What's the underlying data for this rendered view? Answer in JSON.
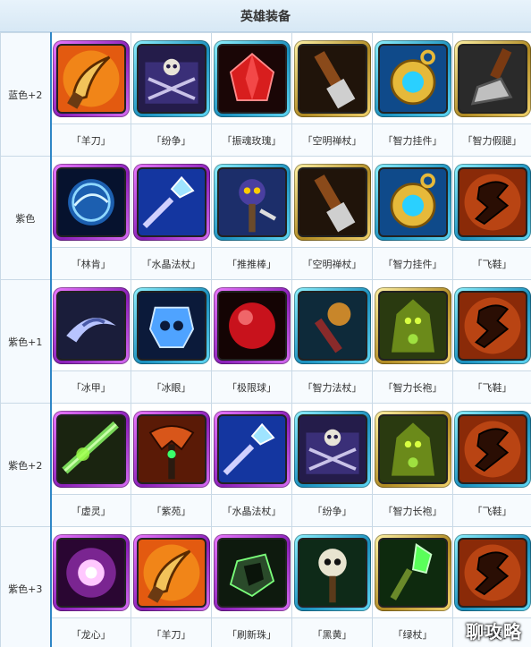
{
  "title": "英雄装备",
  "watermark": "聊攻略",
  "tiers": [
    {
      "label": "蓝色+2",
      "items": [
        {
          "name": "「羊刀」",
          "icon": "curved-blade-icon",
          "frame": "purple"
        },
        {
          "name": "「纷争」",
          "icon": "skull-chest-icon",
          "frame": "blue"
        },
        {
          "name": "「振魂玫瑰」",
          "icon": "red-crystal-icon",
          "frame": "blue"
        },
        {
          "name": "「空明禅杖」",
          "icon": "wooden-staff-icon",
          "frame": "gold"
        },
        {
          "name": "「智力挂件」",
          "icon": "gold-amulet-icon",
          "frame": "blue"
        },
        {
          "name": "「智力假腿」",
          "icon": "mechanical-leg-icon",
          "frame": "gold"
        }
      ]
    },
    {
      "label": "紫色",
      "items": [
        {
          "name": "「林肯」",
          "icon": "blue-orb-icon",
          "frame": "purple"
        },
        {
          "name": "「水晶法杖」",
          "icon": "crystal-scepter-icon",
          "frame": "purple"
        },
        {
          "name": "「推推棒」",
          "icon": "skull-staff-icon",
          "frame": "blue"
        },
        {
          "name": "「空明禅杖」",
          "icon": "wooden-staff-icon",
          "frame": "gold"
        },
        {
          "name": "「智力挂件」",
          "icon": "gold-amulet-icon",
          "frame": "blue"
        },
        {
          "name": "「飞鞋」",
          "icon": "winged-boot-icon",
          "frame": "blue"
        }
      ]
    },
    {
      "label": "紫色+1",
      "items": [
        {
          "name": "「冰甲」",
          "icon": "swirl-armor-icon",
          "frame": "purple"
        },
        {
          "name": "「冰眼」",
          "icon": "ice-skull-icon",
          "frame": "blue"
        },
        {
          "name": "「极限球」",
          "icon": "red-sphere-icon",
          "frame": "purple"
        },
        {
          "name": "「智力法杖」",
          "icon": "fist-staff-icon",
          "frame": "blue"
        },
        {
          "name": "「智力长袍」",
          "icon": "green-robe-icon",
          "frame": "gold"
        },
        {
          "name": "「飞鞋」",
          "icon": "winged-boot-icon",
          "frame": "blue"
        }
      ]
    },
    {
      "label": "紫色+2",
      "items": [
        {
          "name": "「虚灵」",
          "icon": "ethereal-blade-icon",
          "frame": "purple"
        },
        {
          "name": "「紫苑」",
          "icon": "purple-scepter-icon",
          "frame": "purple"
        },
        {
          "name": "「水晶法杖」",
          "icon": "crystal-scepter-icon",
          "frame": "purple"
        },
        {
          "name": "「纷争」",
          "icon": "skull-chest-icon",
          "frame": "blue"
        },
        {
          "name": "「智力长袍」",
          "icon": "green-robe-icon",
          "frame": "gold"
        },
        {
          "name": "「飞鞋」",
          "icon": "winged-boot-icon",
          "frame": "blue"
        }
      ]
    },
    {
      "label": "紫色+3",
      "items": [
        {
          "name": "「龙心」",
          "icon": "glowing-heart-icon",
          "frame": "purple"
        },
        {
          "name": "「羊刀」",
          "icon": "curved-blade-icon",
          "frame": "purple"
        },
        {
          "name": "「刷新珠」",
          "icon": "refresher-orb-icon",
          "frame": "purple"
        },
        {
          "name": "「黑黄」",
          "icon": "skull-totem-icon",
          "frame": "blue"
        },
        {
          "name": "「绿杖」",
          "icon": "green-staff-icon",
          "frame": "gold"
        },
        {
          "name": "「飞鞋」",
          "icon": "winged-boot-icon",
          "frame": "blue"
        }
      ]
    }
  ]
}
